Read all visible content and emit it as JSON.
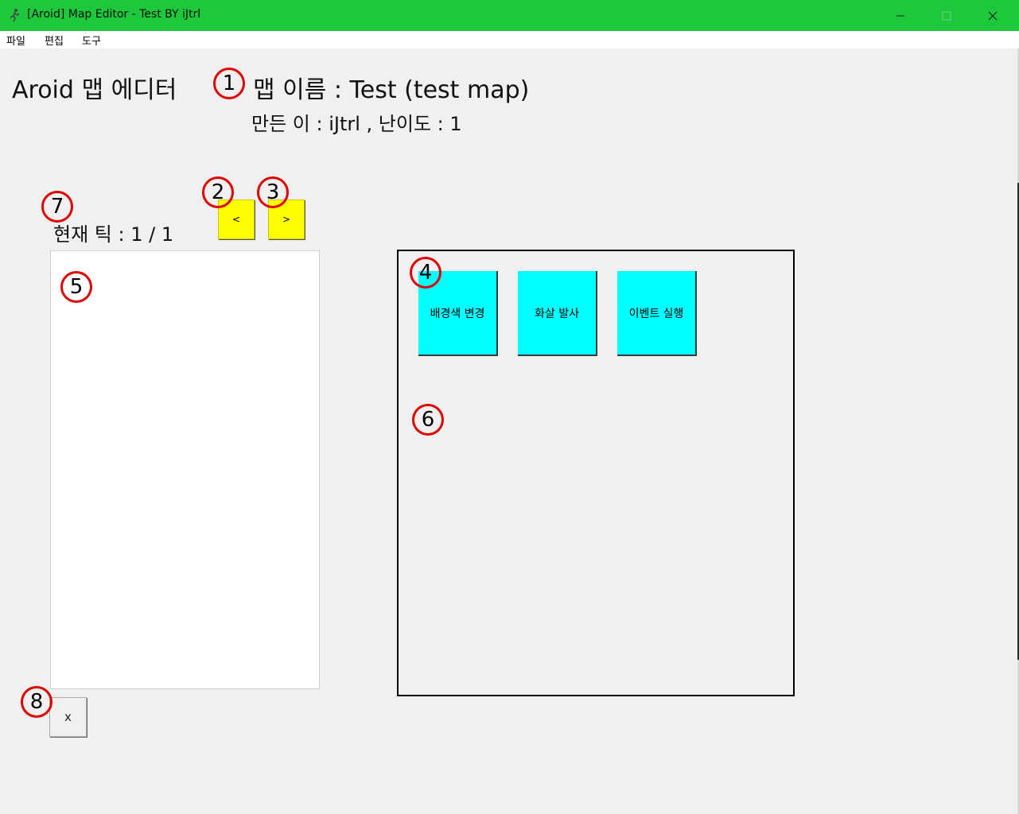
{
  "window": {
    "title": "[Aroid] Map Editor - Test BY iJtrl",
    "icon": "runner-icon",
    "controls": {
      "minimize": "minimize-icon",
      "maximize": "maximize-icon",
      "close": "close-icon"
    }
  },
  "menu": {
    "items": [
      "파일",
      "편집",
      "도구"
    ]
  },
  "header": {
    "app_name": "Aroid 맵 에디터",
    "map_name": "맵 이름 : Test (test map)",
    "author_info": "만든 이 : iJtrl , 난이도 : 1"
  },
  "tick": {
    "label": "현재 틱 : 1 / 1",
    "prev_label": "<",
    "next_label": ">"
  },
  "actions": {
    "buttons": [
      "배경색 변경",
      "화살 발사",
      "이벤트 실행"
    ]
  },
  "delete_button": {
    "label": "x"
  },
  "markers": [
    "1",
    "2",
    "3",
    "4",
    "5",
    "6",
    "7",
    "8"
  ],
  "colors": {
    "titlebar": "#1ec83c",
    "nav_button": "#ffff00",
    "action_button": "#00ffff",
    "marker_ring": "#e00000",
    "background": "#f0f0f0"
  }
}
